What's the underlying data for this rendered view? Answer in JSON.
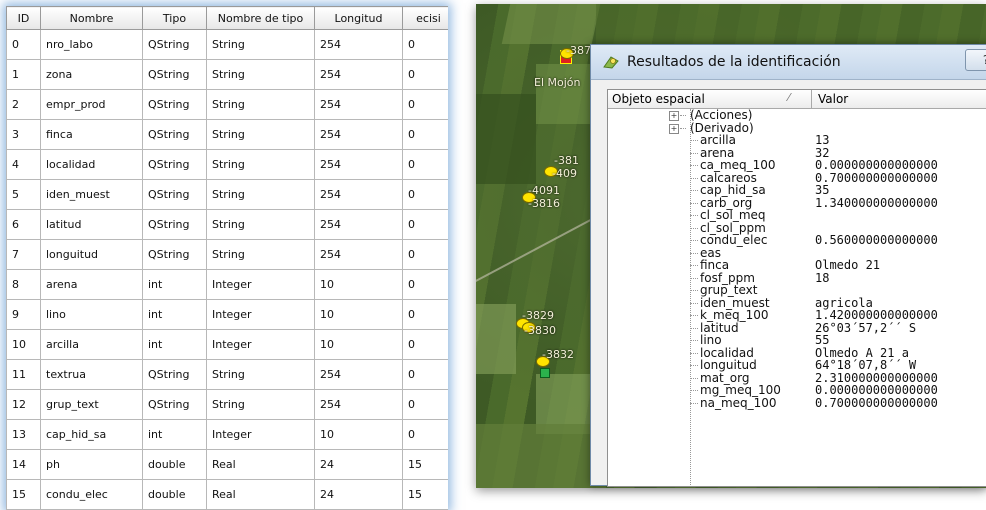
{
  "table": {
    "headers": [
      "ID",
      "Nombre",
      "Tipo",
      "Nombre de tipo",
      "Longitud",
      "ecisi"
    ],
    "rows": [
      [
        "0",
        "nro_labo",
        "QString",
        "String",
        "254",
        "0"
      ],
      [
        "1",
        "zona",
        "QString",
        "String",
        "254",
        "0"
      ],
      [
        "2",
        "empr_prod",
        "QString",
        "String",
        "254",
        "0"
      ],
      [
        "3",
        "finca",
        "QString",
        "String",
        "254",
        "0"
      ],
      [
        "4",
        "localidad",
        "QString",
        "String",
        "254",
        "0"
      ],
      [
        "5",
        "iden_muest",
        "QString",
        "String",
        "254",
        "0"
      ],
      [
        "6",
        "latitud",
        "QString",
        "String",
        "254",
        "0"
      ],
      [
        "7",
        "longuitud",
        "QString",
        "String",
        "254",
        "0"
      ],
      [
        "8",
        "arena",
        "int",
        "Integer",
        "10",
        "0"
      ],
      [
        "9",
        "lino",
        "int",
        "Integer",
        "10",
        "0"
      ],
      [
        "10",
        "arcilla",
        "int",
        "Integer",
        "10",
        "0"
      ],
      [
        "11",
        "textrua",
        "QString",
        "String",
        "254",
        "0"
      ],
      [
        "12",
        "grup_text",
        "QString",
        "String",
        "254",
        "0"
      ],
      [
        "13",
        "cap_hid_sa",
        "int",
        "Integer",
        "10",
        "0"
      ],
      [
        "14",
        "ph",
        "double",
        "Real",
        "24",
        "15"
      ],
      [
        "15",
        "condu_elec",
        "double",
        "Real",
        "24",
        "15"
      ]
    ]
  },
  "map": {
    "labels": [
      "-387",
      "El Mojón",
      "-381",
      "-409",
      "-4091",
      "-3816",
      "-3829",
      "-3830",
      "-3832"
    ]
  },
  "dialog": {
    "title": "Resultados de la identificación",
    "close_label": "?",
    "col_feature": "Objeto espacial",
    "col_value": "Valor",
    "groups": [
      "(Acciones)",
      "(Derivado)"
    ],
    "attributes": [
      {
        "k": "arcilla",
        "v": "13"
      },
      {
        "k": "arena",
        "v": "32"
      },
      {
        "k": "ca_meq_100",
        "v": "0.000000000000000"
      },
      {
        "k": "calcareos",
        "v": "0.700000000000000"
      },
      {
        "k": "cap_hid_sa",
        "v": "35"
      },
      {
        "k": "carb_org",
        "v": "1.340000000000000"
      },
      {
        "k": "cl_sol_meq",
        "v": ""
      },
      {
        "k": "cl_sol_ppm",
        "v": ""
      },
      {
        "k": "condu_elec",
        "v": "0.560000000000000"
      },
      {
        "k": "eas",
        "v": ""
      },
      {
        "k": "finca",
        "v": "Olmedo 21"
      },
      {
        "k": "fosf_ppm",
        "v": "18"
      },
      {
        "k": "grup_text",
        "v": ""
      },
      {
        "k": "iden_muest",
        "v": "agricola"
      },
      {
        "k": "k_meq_100",
        "v": "1.420000000000000"
      },
      {
        "k": "latitud",
        "v": "26°03´57,2´´ S"
      },
      {
        "k": "lino",
        "v": "55"
      },
      {
        "k": "localidad",
        "v": "Olmedo A 21 a"
      },
      {
        "k": "longuitud",
        "v": "64°18´07,8´´ W"
      },
      {
        "k": "mat_org",
        "v": "2.310000000000000"
      },
      {
        "k": "mg_meq_100",
        "v": "0.000000000000000"
      },
      {
        "k": "na_meq_100",
        "v": "0.700000000000000"
      }
    ]
  }
}
